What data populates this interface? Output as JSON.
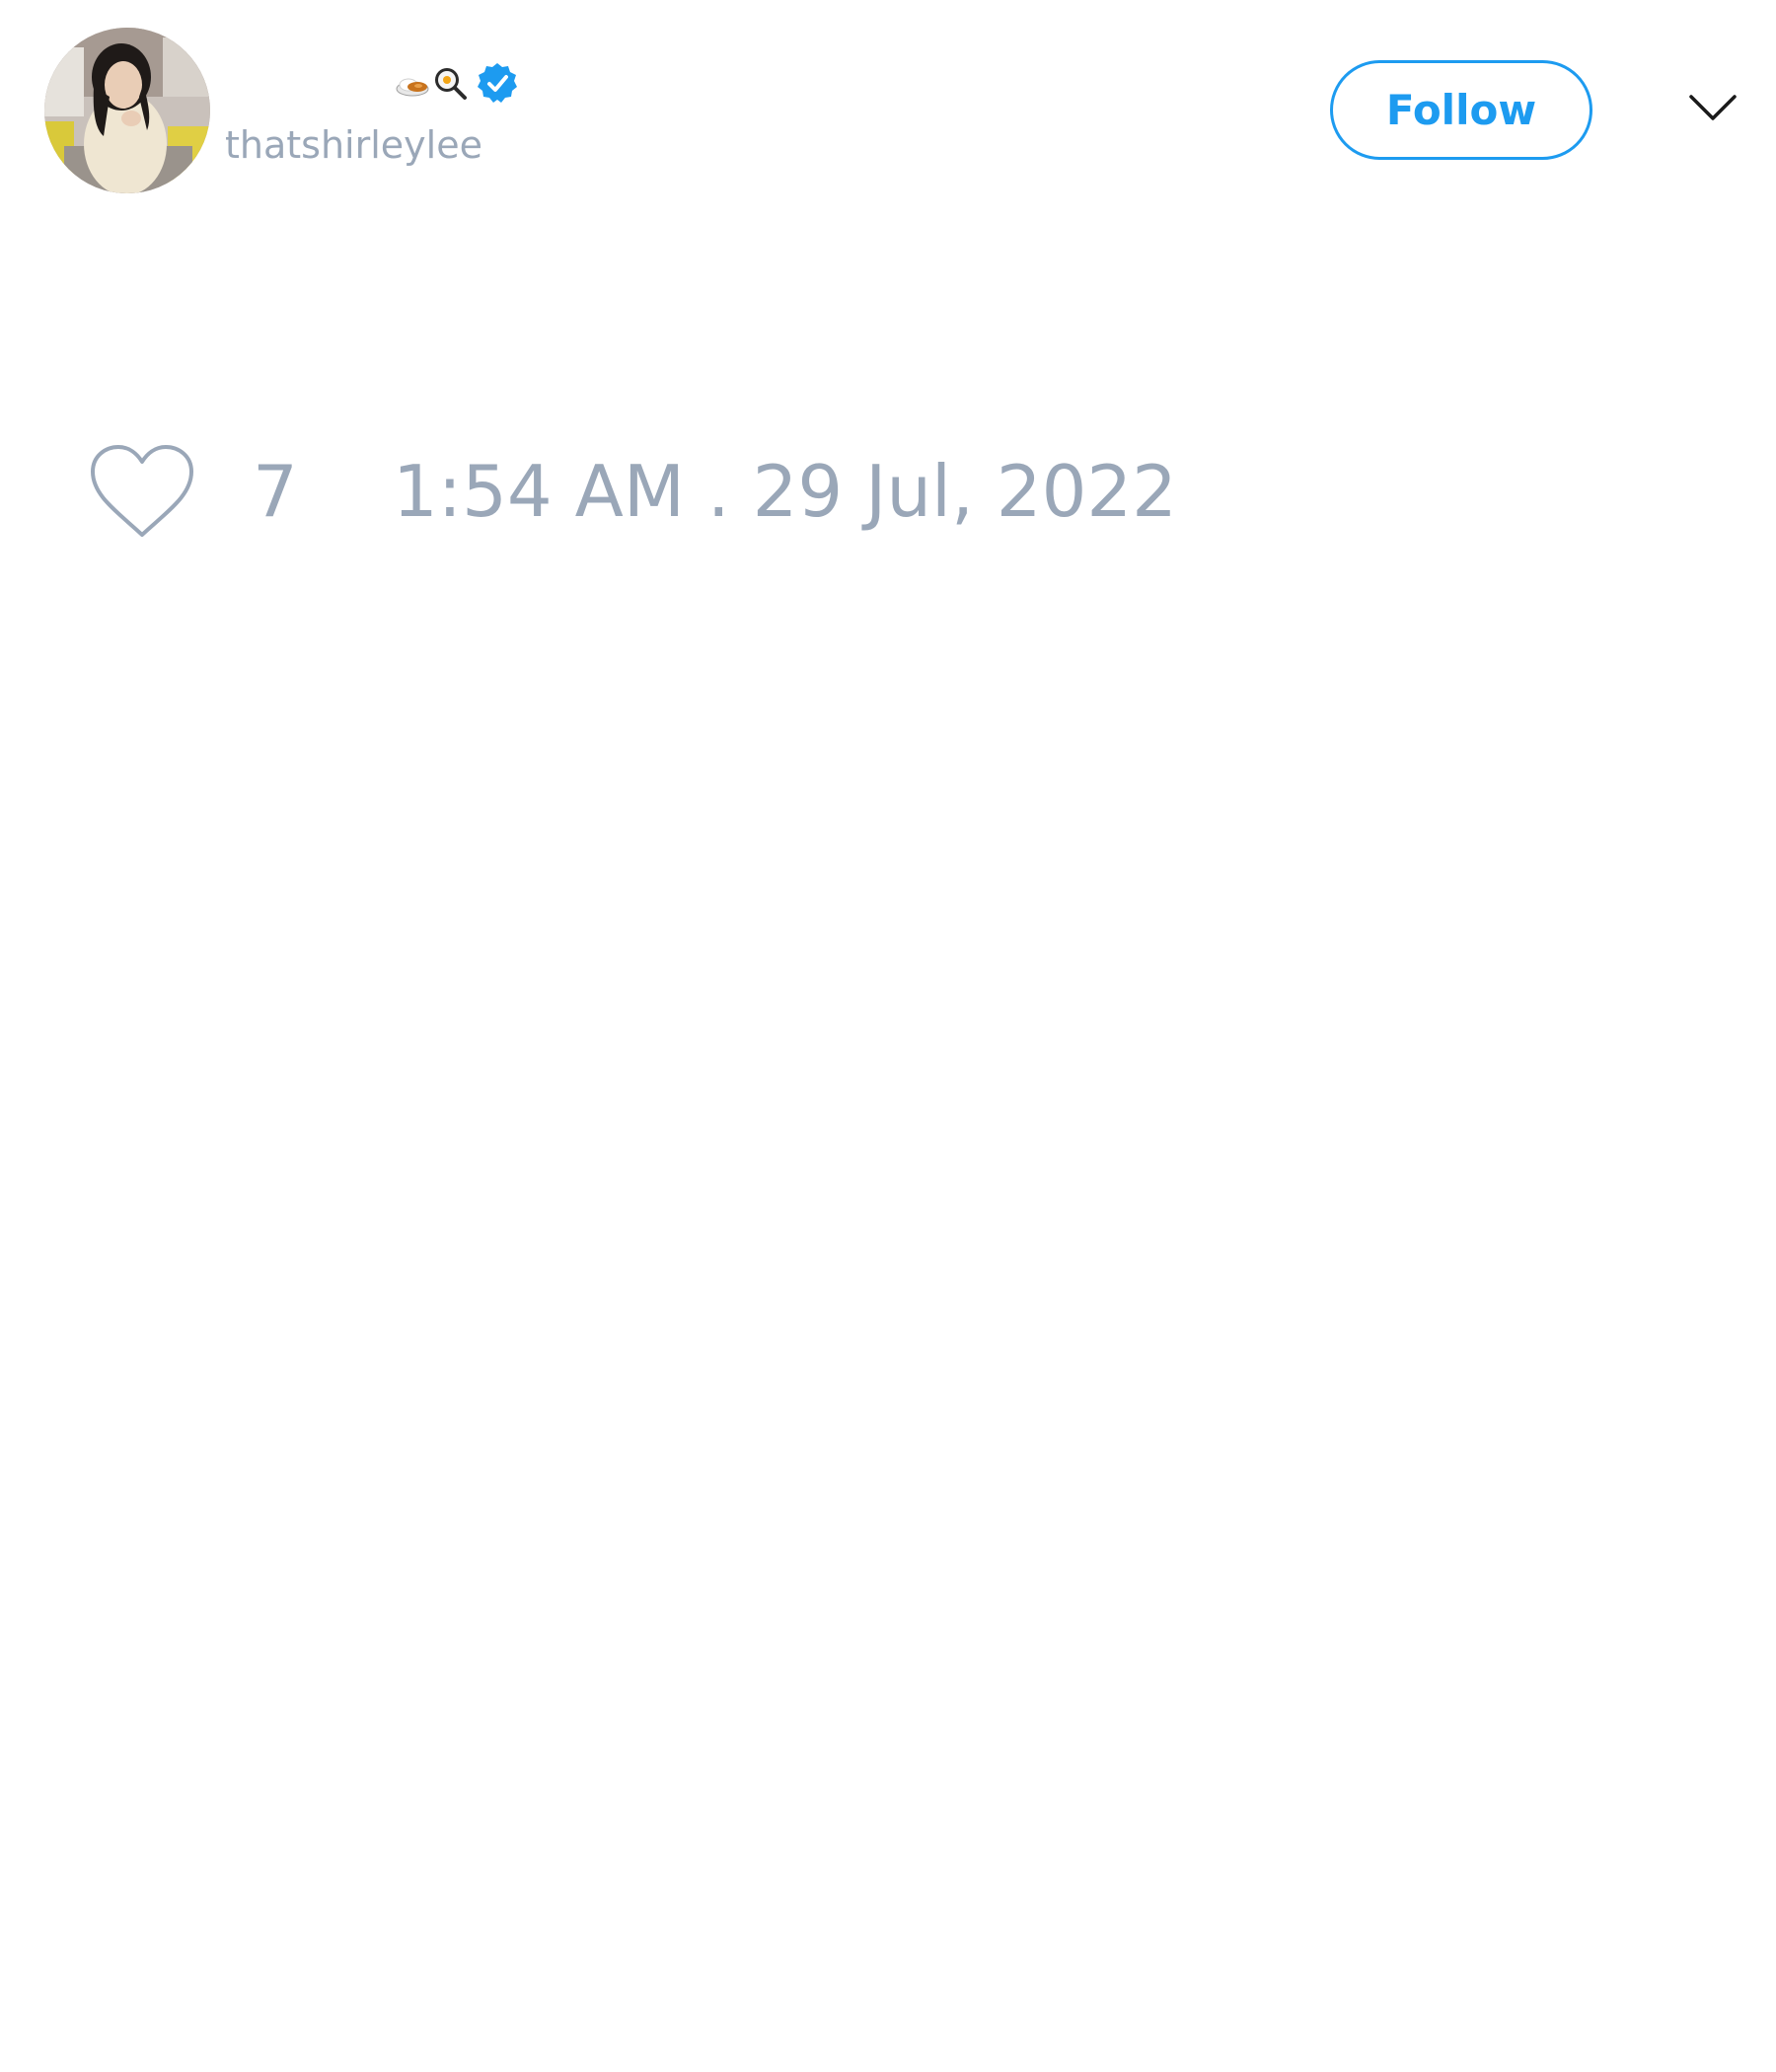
{
  "tweet": {
    "author": {
      "handle": "thatshirleylee",
      "name_emojis": [
        "curry-rice-emoji",
        "frying-pan-egg-emoji"
      ],
      "verified": true
    },
    "follow_label": "Follow",
    "likes": "7",
    "timestamp": "1:54 AM . 29 Jul, 2022"
  },
  "colors": {
    "accent": "#1d9bf0",
    "muted_text": "#9aa7b8",
    "background": "#ffffff"
  }
}
